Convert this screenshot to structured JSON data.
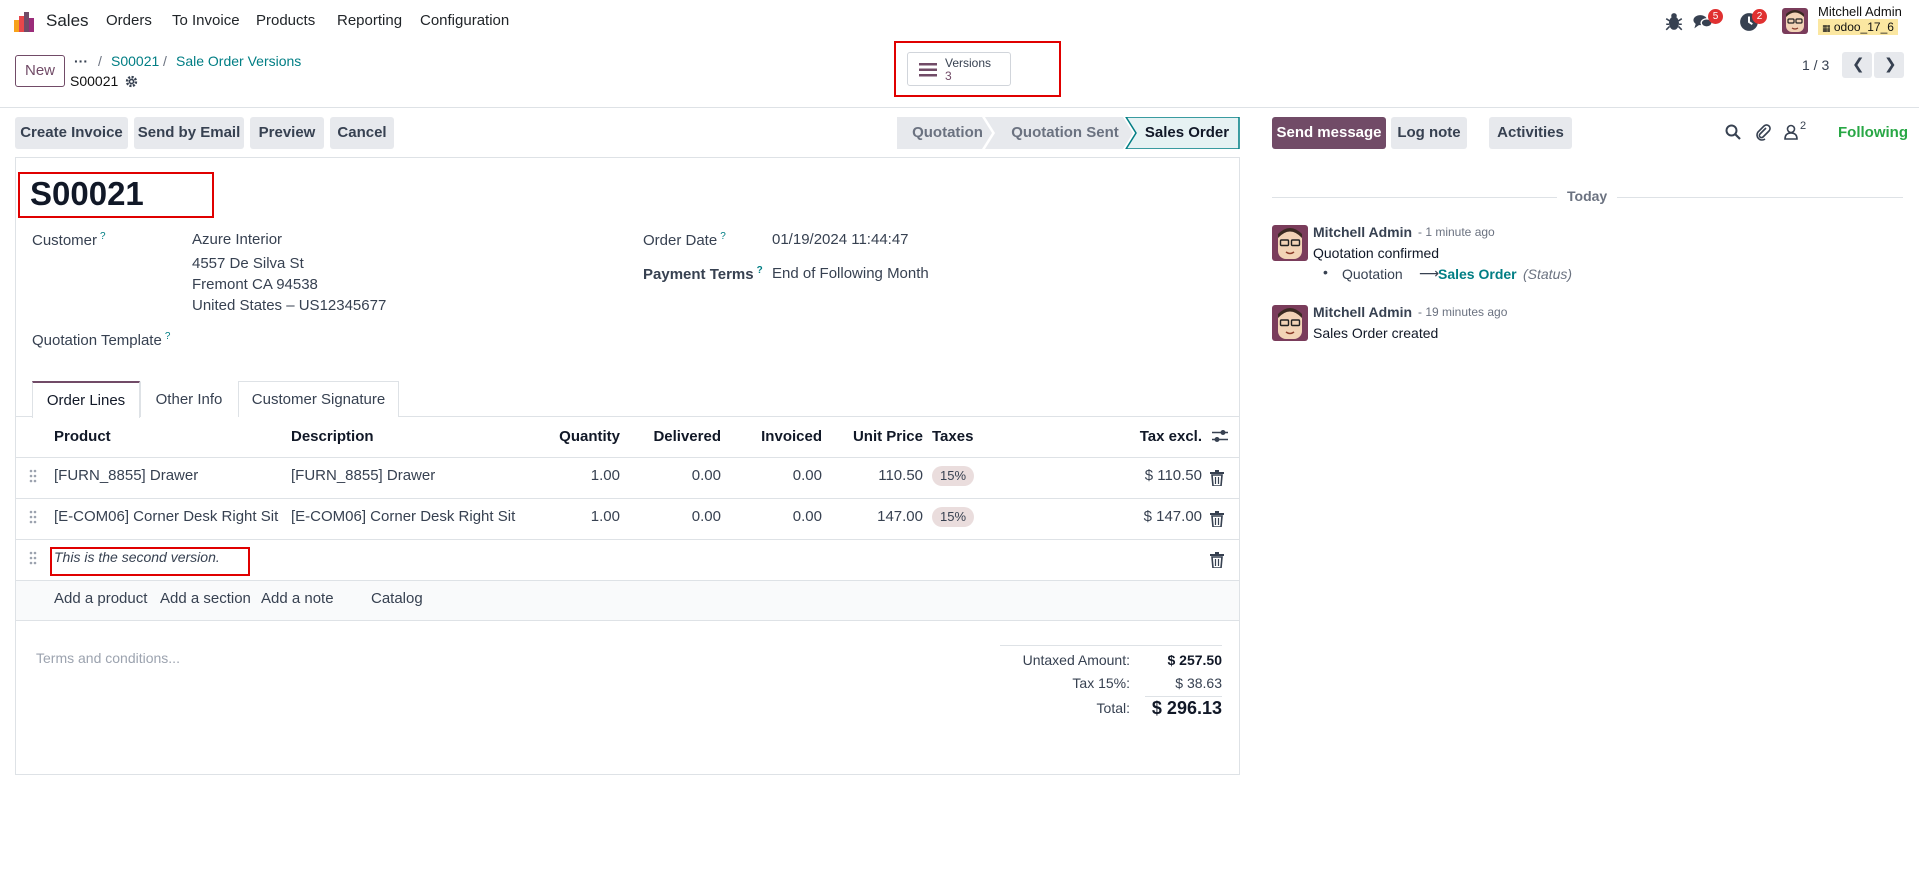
{
  "navbar": {
    "app_name": "Sales",
    "menu": [
      "Orders",
      "To Invoice",
      "Products",
      "Reporting",
      "Configuration"
    ],
    "messages_badge": "5",
    "activities_badge": "2",
    "user_name": "Mitchell Admin",
    "database": "odoo_17_6"
  },
  "control_panel": {
    "new_label": "New",
    "breadcrumb_more": "···",
    "breadcrumb": [
      "S00021",
      "Sale Order Versions"
    ],
    "record_name": "S00021",
    "versions_label": "Versions",
    "versions_count": "3",
    "pager": "1 / 3"
  },
  "actions": {
    "buttons": [
      "Create Invoice",
      "Send by Email",
      "Preview",
      "Cancel"
    ],
    "stages": [
      "Quotation",
      "Quotation Sent",
      "Sales Order"
    ],
    "active_stage": "Sales Order"
  },
  "form": {
    "title": "S00021",
    "customer_label": "Customer",
    "customer_name": "Azure Interior",
    "address": [
      "4557 De Silva St",
      "Fremont CA 94538",
      "United States – US12345677"
    ],
    "template_label": "Quotation Template",
    "order_date_label": "Order Date",
    "order_date": "01/19/2024 11:44:47",
    "payment_terms_label": "Payment Terms",
    "payment_terms": "End of Following Month",
    "help_mark": "?",
    "tabs": [
      "Order Lines",
      "Other Info",
      "Customer Signature"
    ],
    "columns": {
      "product": "Product",
      "description": "Description",
      "quantity": "Quantity",
      "delivered": "Delivered",
      "invoiced": "Invoiced",
      "unit_price": "Unit Price",
      "taxes": "Taxes",
      "tax_excl": "Tax excl."
    },
    "lines": [
      {
        "product": "[FURN_8855] Drawer",
        "description": "[FURN_8855] Drawer",
        "quantity": "1.00",
        "delivered": "0.00",
        "invoiced": "0.00",
        "unit_price": "110.50",
        "tax": "15%",
        "subtotal": "$ 110.50"
      },
      {
        "product": "[E-COM06] Corner Desk Right Sit",
        "description": "[E-COM06] Corner Desk Right Sit",
        "quantity": "1.00",
        "delivered": "0.00",
        "invoiced": "0.00",
        "unit_price": "147.00",
        "tax": "15%",
        "subtotal": "$ 147.00"
      }
    ],
    "note_line": "This is the second version.",
    "add_links": [
      "Add a product",
      "Add a section",
      "Add a note",
      "Catalog"
    ],
    "terms_placeholder": "Terms and conditions...",
    "totals": {
      "untaxed_label": "Untaxed Amount:",
      "untaxed": "$ 257.50",
      "tax_label": "Tax 15%:",
      "tax": "$ 38.63",
      "total_label": "Total:",
      "total": "$ 296.13"
    }
  },
  "chatter": {
    "send_message": "Send message",
    "log_note": "Log note",
    "activities": "Activities",
    "followers_count": "2",
    "following": "Following",
    "date_separator": "Today",
    "messages": [
      {
        "author": "Mitchell Admin",
        "time": "- 1 minute ago",
        "body": "Quotation confirmed",
        "tracking_old": "Quotation",
        "tracking_new": "Sales Order",
        "tracking_field": "(Status)"
      },
      {
        "author": "Mitchell Admin",
        "time": "- 19 minutes ago",
        "body": "Sales Order created"
      }
    ]
  },
  "colors": {
    "primary": "#714b67",
    "link": "#017e84",
    "highlight": "#e00000",
    "following": "#28a745"
  }
}
